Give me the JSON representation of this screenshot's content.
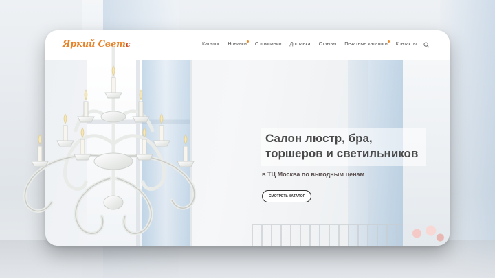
{
  "header": {
    "logo_text": "Яркий Свет",
    "nav": [
      {
        "label": "Каталог",
        "has_dot": false
      },
      {
        "label": "Новинки",
        "has_dot": true
      },
      {
        "label": "О компании",
        "has_dot": false
      },
      {
        "label": "Доставка",
        "has_dot": false
      },
      {
        "label": "Отзывы",
        "has_dot": false
      },
      {
        "label": "Печатные каталоги",
        "has_dot": true
      },
      {
        "label": "Контакты",
        "has_dot": false
      }
    ],
    "search_icon": "search-icon"
  },
  "hero": {
    "headline_line1": "Салон люстр, бра,",
    "headline_line2": "торшеров и светильников",
    "subheadline": "в ТЦ Москва по выгодным ценам",
    "cta_label": "Смотреть каталог"
  },
  "colors": {
    "accent": "#f08a24",
    "logo": "#e8832a",
    "headline": "#4a4a4a"
  }
}
